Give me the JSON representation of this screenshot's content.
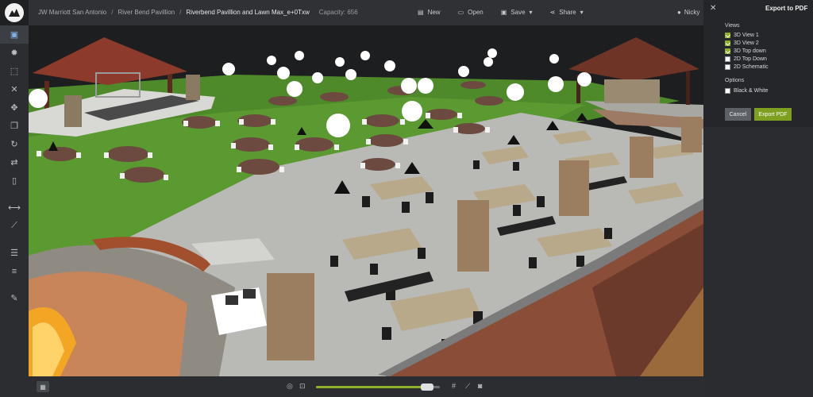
{
  "breadcrumb": {
    "items": [
      "JW Marriott San Antonio",
      "River Bend Pavillion",
      "Riverbend Pavillion and Lawn Max_e+0Txw"
    ],
    "separator": "/",
    "capacity": "Capacity: 656"
  },
  "toolbar": {
    "new_label": "New",
    "open_label": "Open",
    "save_label": "Save",
    "share_label": "Share",
    "dropdown_glyph": "▾"
  },
  "user": {
    "name": "Nicky"
  },
  "left_tools": [
    {
      "icon": "cube-3d-icon",
      "glyph": "▣",
      "active": true
    },
    {
      "icon": "sun-light-icon",
      "glyph": "✹"
    },
    {
      "icon": "frame-select-icon",
      "glyph": "⬚"
    },
    {
      "icon": "close-x-icon",
      "glyph": "✕"
    },
    {
      "icon": "move-arrows-icon",
      "glyph": "✥"
    },
    {
      "icon": "copy-icon",
      "glyph": "❐"
    },
    {
      "icon": "rotate-icon",
      "glyph": "↻"
    },
    {
      "icon": "swap-arrows-icon",
      "glyph": "⇄"
    },
    {
      "icon": "trash-icon",
      "glyph": "▯"
    },
    {
      "icon": "measure-width-icon",
      "glyph": "⟷"
    },
    {
      "icon": "ruler-icon",
      "glyph": "⟋"
    },
    {
      "icon": "align-center-icon",
      "glyph": "☰"
    },
    {
      "icon": "distribute-icon",
      "glyph": "≡"
    },
    {
      "icon": "edit-note-icon",
      "glyph": "✎"
    }
  ],
  "bottom": {
    "view_toggle_glyph": "▦",
    "zoom_percent": 94,
    "icons": [
      {
        "name": "target-icon",
        "glyph": "◎"
      },
      {
        "name": "frame-icon",
        "glyph": "⊡"
      },
      {
        "name": "grid-hash-icon",
        "glyph": "#"
      },
      {
        "name": "pencil-icon",
        "glyph": "⟋"
      },
      {
        "name": "camera-icon",
        "glyph": "◙"
      }
    ]
  },
  "export_panel": {
    "title": "Export to PDF",
    "close_glyph": "✕",
    "views_label": "Views",
    "views": [
      {
        "label": "3D View 1",
        "checked": true
      },
      {
        "label": "3D View 2",
        "checked": true
      },
      {
        "label": "3D Top down",
        "checked": true
      },
      {
        "label": "2D Top Down",
        "checked": false
      },
      {
        "label": "2D Schematic",
        "checked": false
      }
    ],
    "options_label": "Options",
    "options": [
      {
        "label": "Black & White",
        "checked": false
      }
    ],
    "cancel_label": "Cancel",
    "export_label": "Export PDF"
  },
  "colors": {
    "accent_green": "#8fb12a",
    "export_button": "#7e9f1f",
    "active_tool": "#7fb1e5"
  }
}
